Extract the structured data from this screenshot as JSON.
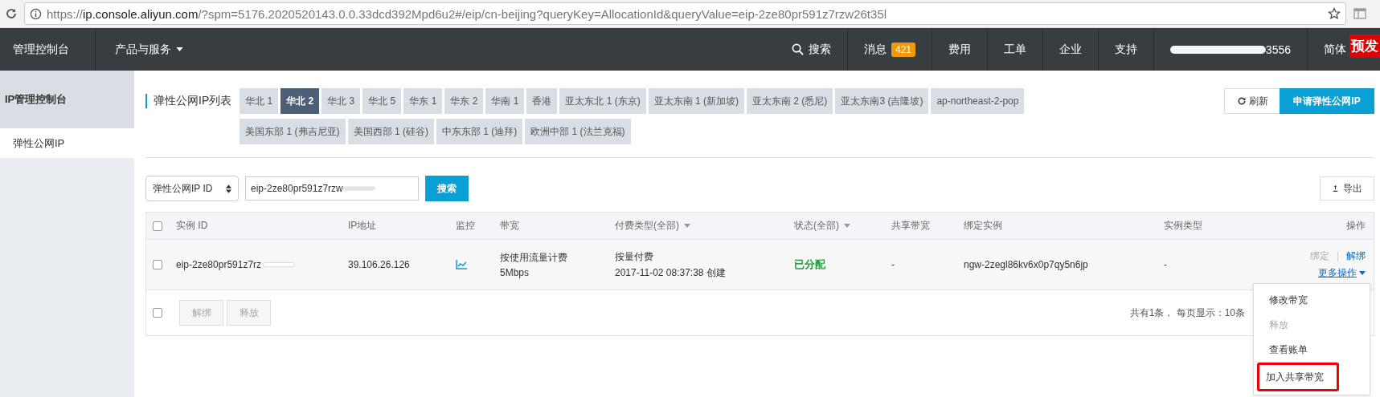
{
  "browser": {
    "url_scheme": "https://",
    "url_host": "ip.console.aliyun.com",
    "url_rest": "/?spm=5176.2020520143.0.0.33dcd392Mpd6u2#/eip/cn-beijing?queryKey=AllocationId&queryValue=eip-2ze80pr591z7rzw26t35l"
  },
  "topnav": {
    "home": "管理控制台",
    "products": "产品与服务",
    "search": "搜索",
    "items": [
      {
        "label": "消息",
        "badge": "421"
      },
      {
        "label": "费用"
      },
      {
        "label": "工单"
      },
      {
        "label": "企业"
      },
      {
        "label": "支持"
      },
      {
        "label": "3556",
        "kind": "account"
      },
      {
        "label": "简体",
        "kind": "lang"
      }
    ],
    "corner_badge": "预发"
  },
  "sidebar": {
    "title": "IP管理控制台",
    "items": [
      {
        "label": "弹性公网IP",
        "selected": true
      }
    ]
  },
  "list_title": "弹性公网IP列表",
  "region_rows": [
    [
      {
        "label": "华北 1",
        "selected": false
      },
      {
        "label": "华北 2",
        "selected": true
      },
      {
        "label": "华北 3",
        "selected": false
      },
      {
        "label": "华北 5",
        "selected": false
      },
      {
        "label": "华东 1",
        "selected": false
      },
      {
        "label": "华东 2",
        "selected": false
      },
      {
        "label": "华南 1",
        "selected": false
      },
      {
        "label": "香港",
        "selected": false
      },
      {
        "label": "亚太东北 1 (东京)",
        "selected": false
      },
      {
        "label": "亚太东南 1 (新加坡)",
        "selected": false
      },
      {
        "label": "亚太东南 2 (悉尼)",
        "selected": false
      },
      {
        "label": "亚太东南3 (吉隆坡)",
        "selected": false
      },
      {
        "label": "ap-northeast-2-pop",
        "selected": false
      }
    ],
    [
      {
        "label": "美国东部 1 (弗吉尼亚)",
        "selected": false
      },
      {
        "label": "美国西部 1 (硅谷)",
        "selected": false
      },
      {
        "label": "中东东部 1 (迪拜)",
        "selected": false
      },
      {
        "label": "欧洲中部 1 (法兰克福)",
        "selected": false
      }
    ]
  ],
  "actions": {
    "refresh": "刷新",
    "apply": "申请弹性公网IP",
    "export": "导出"
  },
  "search": {
    "field_type": "弹性公网IP ID",
    "value": "eip-2ze80pr591z7rzw",
    "button": "搜索"
  },
  "table": {
    "header_checked": false,
    "columns": [
      {
        "label": "实例 ID"
      },
      {
        "label": "IP地址"
      },
      {
        "label": "监控"
      },
      {
        "label": "带宽"
      },
      {
        "label": "付费类型(全部)",
        "filter": true
      },
      {
        "label": "状态(全部)",
        "filter": true
      },
      {
        "label": "共享带宽"
      },
      {
        "label": "绑定实例"
      },
      {
        "label": "实例类型"
      },
      {
        "label": "操作"
      }
    ],
    "rows": [
      {
        "checked": false,
        "id": "eip-2ze80pr591z7rz",
        "ip": "39.106.26.126",
        "bandwidth": [
          "按使用流量计费",
          "5Mbps"
        ],
        "billing": [
          "按量付费",
          "2017-11-02 08:37:38 创建"
        ],
        "status": {
          "label": "已分配",
          "color": "#1e9f3a"
        },
        "shared": "-",
        "bound": "ngw-2zegl86kv6x0p7qy5n6jp",
        "instance_type": "-",
        "ops": [
          {
            "label": "绑定",
            "disabled": true
          },
          {
            "label": "解绑",
            "disabled": false
          }
        ],
        "more": "更多操作"
      }
    ],
    "footer": {
      "checked": false,
      "buttons": [
        {
          "label": "解绑",
          "disabled": true
        },
        {
          "label": "释放",
          "disabled": true
        }
      ],
      "summary": "共有1条， 每页显示：10条"
    }
  },
  "menu": [
    {
      "label": "修改带宽",
      "disabled": false,
      "outlined": false
    },
    {
      "label": "释放",
      "disabled": true,
      "outlined": false
    },
    {
      "label": "查看账单",
      "disabled": false,
      "outlined": false
    },
    {
      "label": "加入共享带宽",
      "disabled": false,
      "outlined": true
    }
  ]
}
